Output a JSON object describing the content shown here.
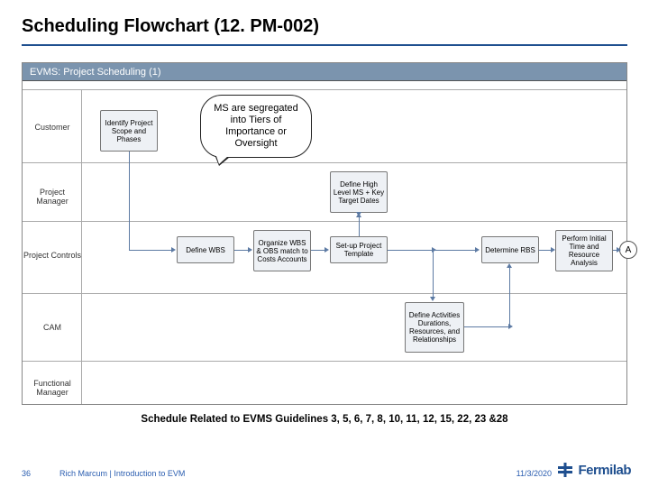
{
  "title": "Scheduling Flowchart (12. PM-002)",
  "chart_header": "EVMS: Project Scheduling (1)",
  "lanes": {
    "customer": "Customer",
    "pm": "Project Manager",
    "pc": "Project Controls",
    "cam": "CAM",
    "fm": "Functional Manager"
  },
  "boxes": {
    "identify_scope": "Identify Project Scope and Phases",
    "define_ms": "Define High Level MS + Key Target Dates",
    "define_wbs": "Define WBS",
    "organize_wbs_obs": "Organize WBS & OBS match to Costs Accounts",
    "setup_template": "Set-up Project Template",
    "determine_rbs": "Determine RBS",
    "perform_analysis": "Perform Initial Time and Resource Analysis",
    "define_activities": "Define Activities Durations, Resources, and Relationships"
  },
  "connector": "A",
  "callout": "MS are segregated into Tiers of Importance or Oversight",
  "caption": "Schedule Related to EVMS Guidelines 3, 5, 6, 7, 8, 10, 11, 12, 15, 22, 23 &28",
  "footer": {
    "page": "36",
    "presenter": "Rich Marcum | Introduction to EVM",
    "date": "11/3/2020",
    "logo": "Fermilab"
  }
}
